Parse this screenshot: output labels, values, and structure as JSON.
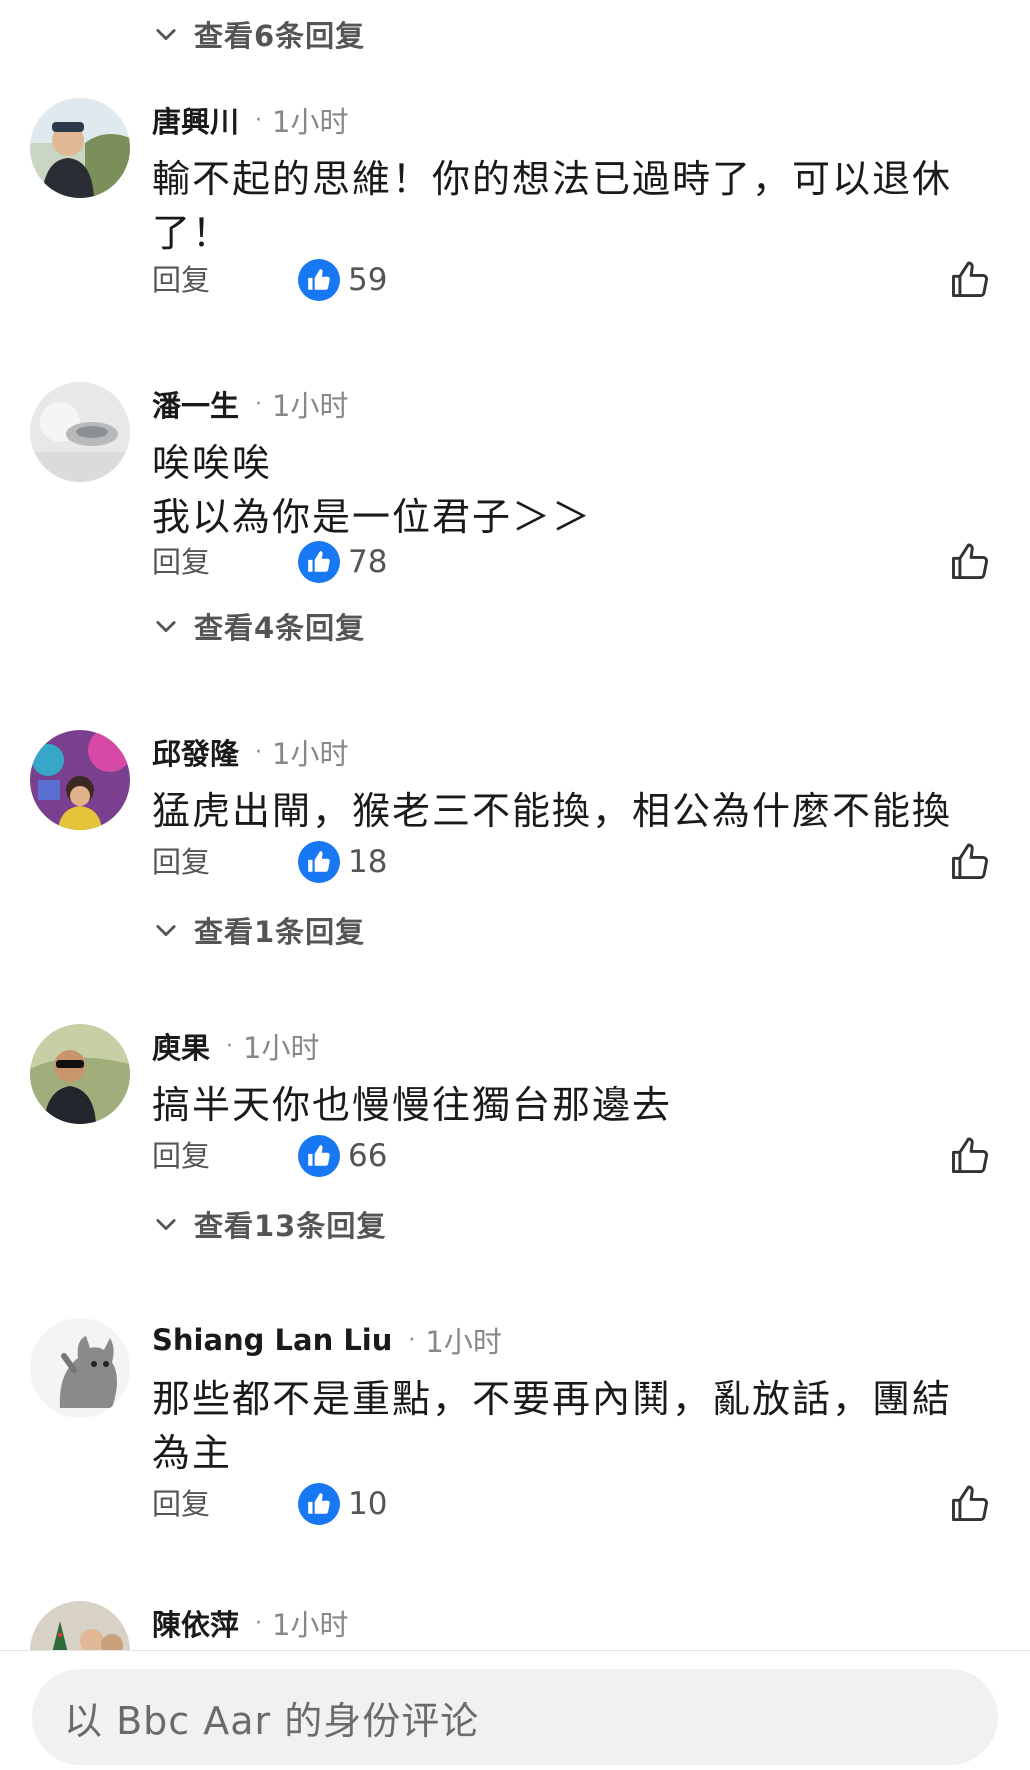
{
  "comments": [
    {
      "name": "唐興川",
      "time": "1小时",
      "text_lines": [
        "輸不起的思維！你的想法已過時了，可以退休",
        "了！"
      ],
      "reply_label": "回复",
      "likes": "59",
      "view_replies": ""
    },
    {
      "name": "潘一生",
      "time": "1小时",
      "text_lines": [
        "唉唉唉",
        "我以為你是一位君子＞＞"
      ],
      "reply_label": "回复",
      "likes": "78",
      "view_replies": "查看4条回复"
    },
    {
      "name": "邱發隆",
      "time": "1小时",
      "text_lines": [
        "猛虎出閘，猴老三不能換，相公為什麼不能換"
      ],
      "reply_label": "回复",
      "likes": "18",
      "view_replies": "查看1条回复"
    },
    {
      "name": "庾果",
      "time": "1小时",
      "text_lines": [
        "搞半天你也慢慢往獨台那邊去"
      ],
      "reply_label": "回复",
      "likes": "66",
      "view_replies": "查看13条回复"
    },
    {
      "name": "Shiang Lan Liu",
      "time": "1小时",
      "text_lines": [
        "那些都不是重點，不要再內鬨，亂放話，團結",
        "為主"
      ],
      "reply_label": "回复",
      "likes": "10",
      "view_replies": ""
    },
    {
      "name": "陳依萍",
      "time": "1小时"
    }
  ],
  "top_view_replies": "查看6条回复",
  "composer": {
    "placeholder": "以 Bbc Aar 的身份评论"
  },
  "colors": {
    "like_badge": "#1877f2",
    "muted_text": "#555555",
    "time_text": "#888888"
  }
}
